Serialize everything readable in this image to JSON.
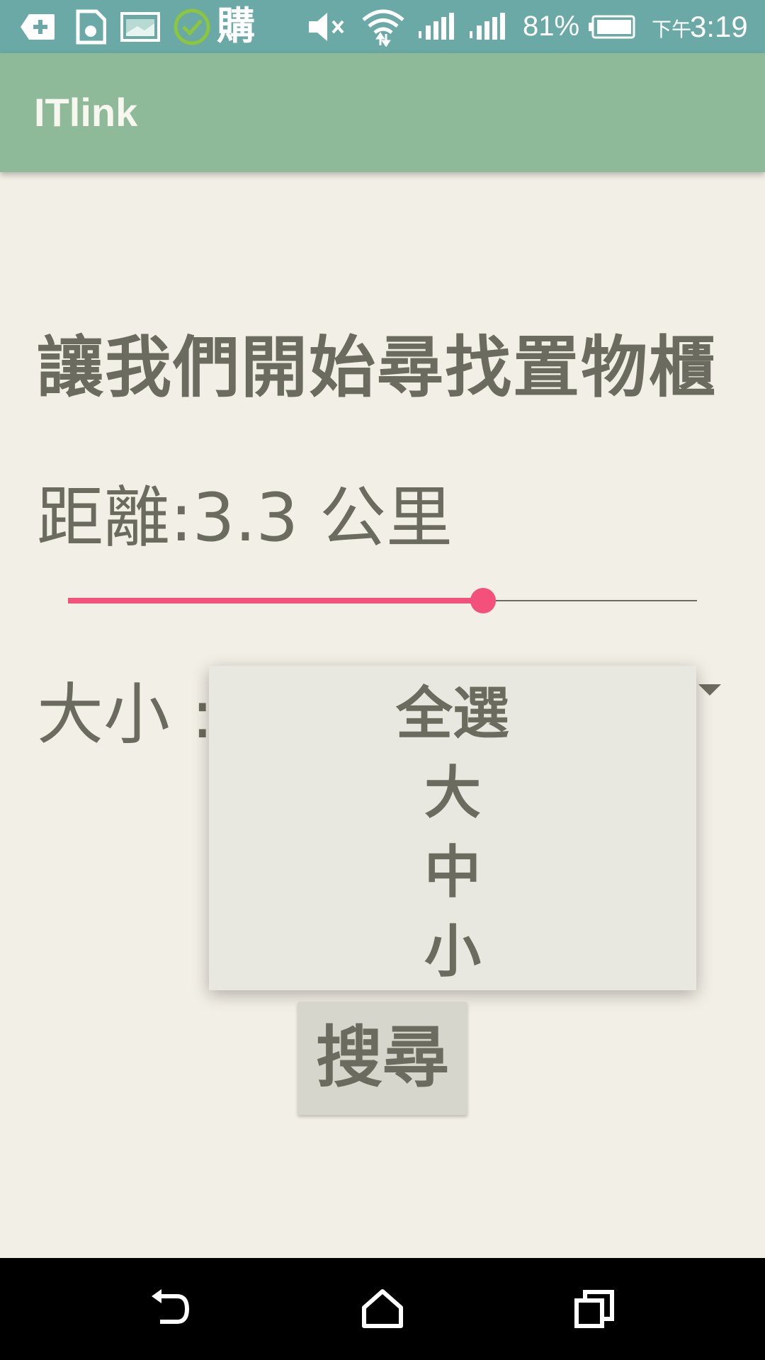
{
  "status_bar": {
    "battery_percent": "81%",
    "clock_prefix": "下午",
    "clock_time": "3:19",
    "notification_char": "購"
  },
  "app_bar": {
    "title": "ITlink"
  },
  "main": {
    "heading": "讓我們開始尋找置物櫃",
    "distance_label": "距離:3.3 公里",
    "slider_fraction": 0.66,
    "size_label": "大小 :",
    "size_options": [
      "全選",
      "大",
      "中",
      "小"
    ],
    "search_button_label": "搜尋"
  },
  "colors": {
    "status_bar": "#6aa9a5",
    "app_bar": "#8fba99",
    "background": "#f2efe6",
    "accent": "#f4507c"
  }
}
